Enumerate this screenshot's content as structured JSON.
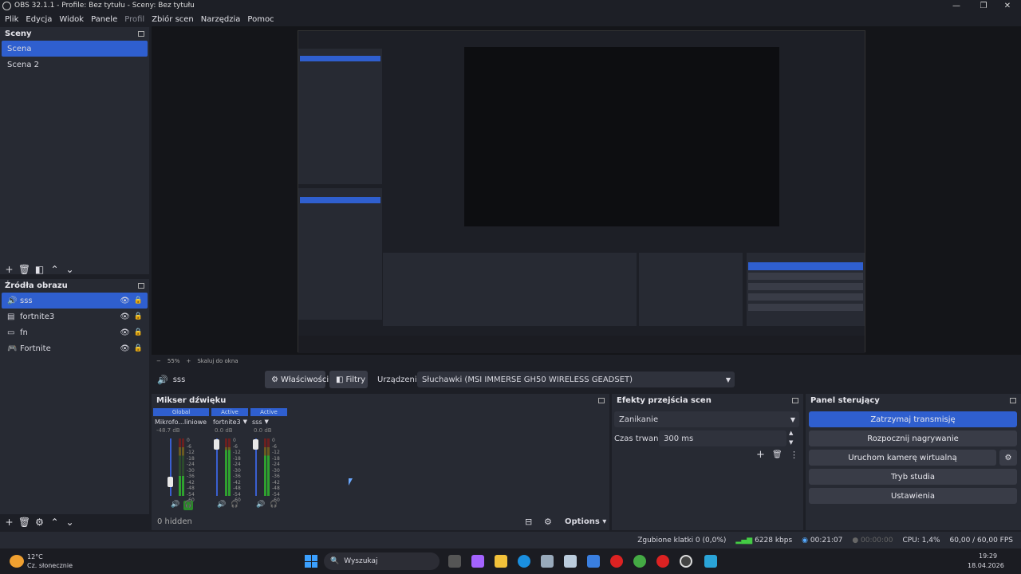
{
  "window": {
    "title": "OBS 32.1.1 - Profile: Bez tytułu - Sceny: Bez tytułu"
  },
  "menu": [
    "Plik",
    "Edycja",
    "Widok",
    "Panele",
    "Profil",
    "Zbiór scen",
    "Narzędzia",
    "Pomoc"
  ],
  "scenes": {
    "title": "Sceny",
    "items": [
      "Scena",
      "Scena 2"
    ]
  },
  "sources": {
    "title": "Źródła obrazu",
    "items": [
      "sss",
      "fortnite3",
      "fn",
      "Fortnite"
    ]
  },
  "preview": {
    "zoom": "55%",
    "scale_mode": "Skaluj do okna"
  },
  "props": {
    "source_name": "sss",
    "properties_btn": "Właściwości",
    "filters_btn": "Filtry",
    "device_label": "Urządzenie",
    "device_value": "Słuchawki (MSI IMMERSE GH50 WIRELESS GEADSET)"
  },
  "mixer": {
    "title": "Mikser dźwięku",
    "strips": [
      {
        "head": "Global",
        "name": "Mikrofo...liniowe",
        "db": "-48.7 dB"
      },
      {
        "head": "Active",
        "name": "fortnite3",
        "db": "0.0 dB"
      },
      {
        "head": "Active",
        "name": "sss",
        "db": "0.0 dB"
      }
    ],
    "scale": [
      "0",
      "-6",
      "-12",
      "-18",
      "-24",
      "-30",
      "-36",
      "-42",
      "-48",
      "-54",
      "-60"
    ],
    "hidden": "0 hidden",
    "options": "Options"
  },
  "transitions": {
    "title": "Efekty przejścia scen",
    "type": "Zanikanie",
    "duration_label": "Czas trwania",
    "duration": "300 ms"
  },
  "controls": {
    "title": "Panel sterujący",
    "stop_stream": "Zatrzymaj transmisję",
    "start_record": "Rozpocznij nagrywanie",
    "virtual_cam": "Uruchom kamerę wirtualną",
    "studio_mode": "Tryb studia",
    "settings": "Ustawienia"
  },
  "status": {
    "dropped": "Zgubione klatki 0 (0,0%)",
    "bitrate": "6228 kbps",
    "stream_time": "00:21:07",
    "rec_time": "00:00:00",
    "cpu": "CPU: 1,4%",
    "fps": "60,00 / 60,00 FPS"
  },
  "taskbar": {
    "weather_temp": "12°C",
    "weather_desc": "Cz. słonecznie",
    "search": "Wyszukaj",
    "time": "19:29",
    "date": "18.04.2026"
  },
  "colors": {
    "accent": "#2f5fcf",
    "bg": "#1d1f26",
    "panel": "#272a33",
    "button": "#393c47"
  }
}
